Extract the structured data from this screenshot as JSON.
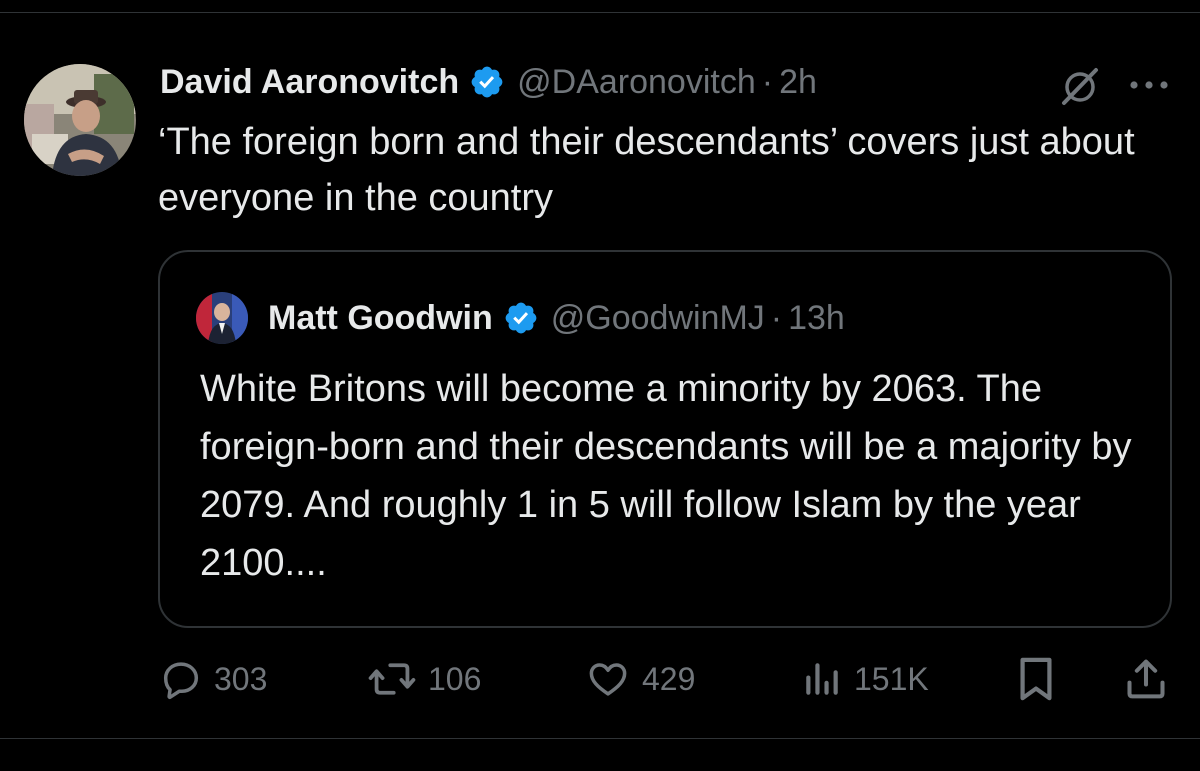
{
  "tweet": {
    "author": {
      "display_name": "David Aaronovitch",
      "handle": "@DAaronovitch",
      "time": "2h",
      "separator": "·"
    },
    "text": "‘The foreign born and their descendants’ covers just about everyone in the country",
    "quote": {
      "author": {
        "display_name": "Matt Goodwin",
        "handle": "@GoodwinMJ",
        "time": "13h",
        "separator": "·"
      },
      "text": "White Britons will become a minority by 2063. The foreign-born and their descendants will be a majority by 2079. And roughly 1 in 5 will follow Islam by the year 2100...."
    },
    "stats": {
      "replies": "303",
      "reposts": "106",
      "likes": "429",
      "views": "151K"
    }
  },
  "icons": {
    "verified": "verified-badge-icon",
    "grok": "grok-icon",
    "more": "more-options-icon",
    "reply": "reply-icon",
    "repost": "repost-icon",
    "like": "heart-icon",
    "views": "views-chart-icon",
    "bookmark": "bookmark-icon",
    "share": "share-icon"
  },
  "colors": {
    "background": "#000000",
    "text_primary": "#e7e9ea",
    "text_secondary": "#71767b",
    "verified_blue": "#1d9bf0",
    "border": "#2f3336"
  }
}
